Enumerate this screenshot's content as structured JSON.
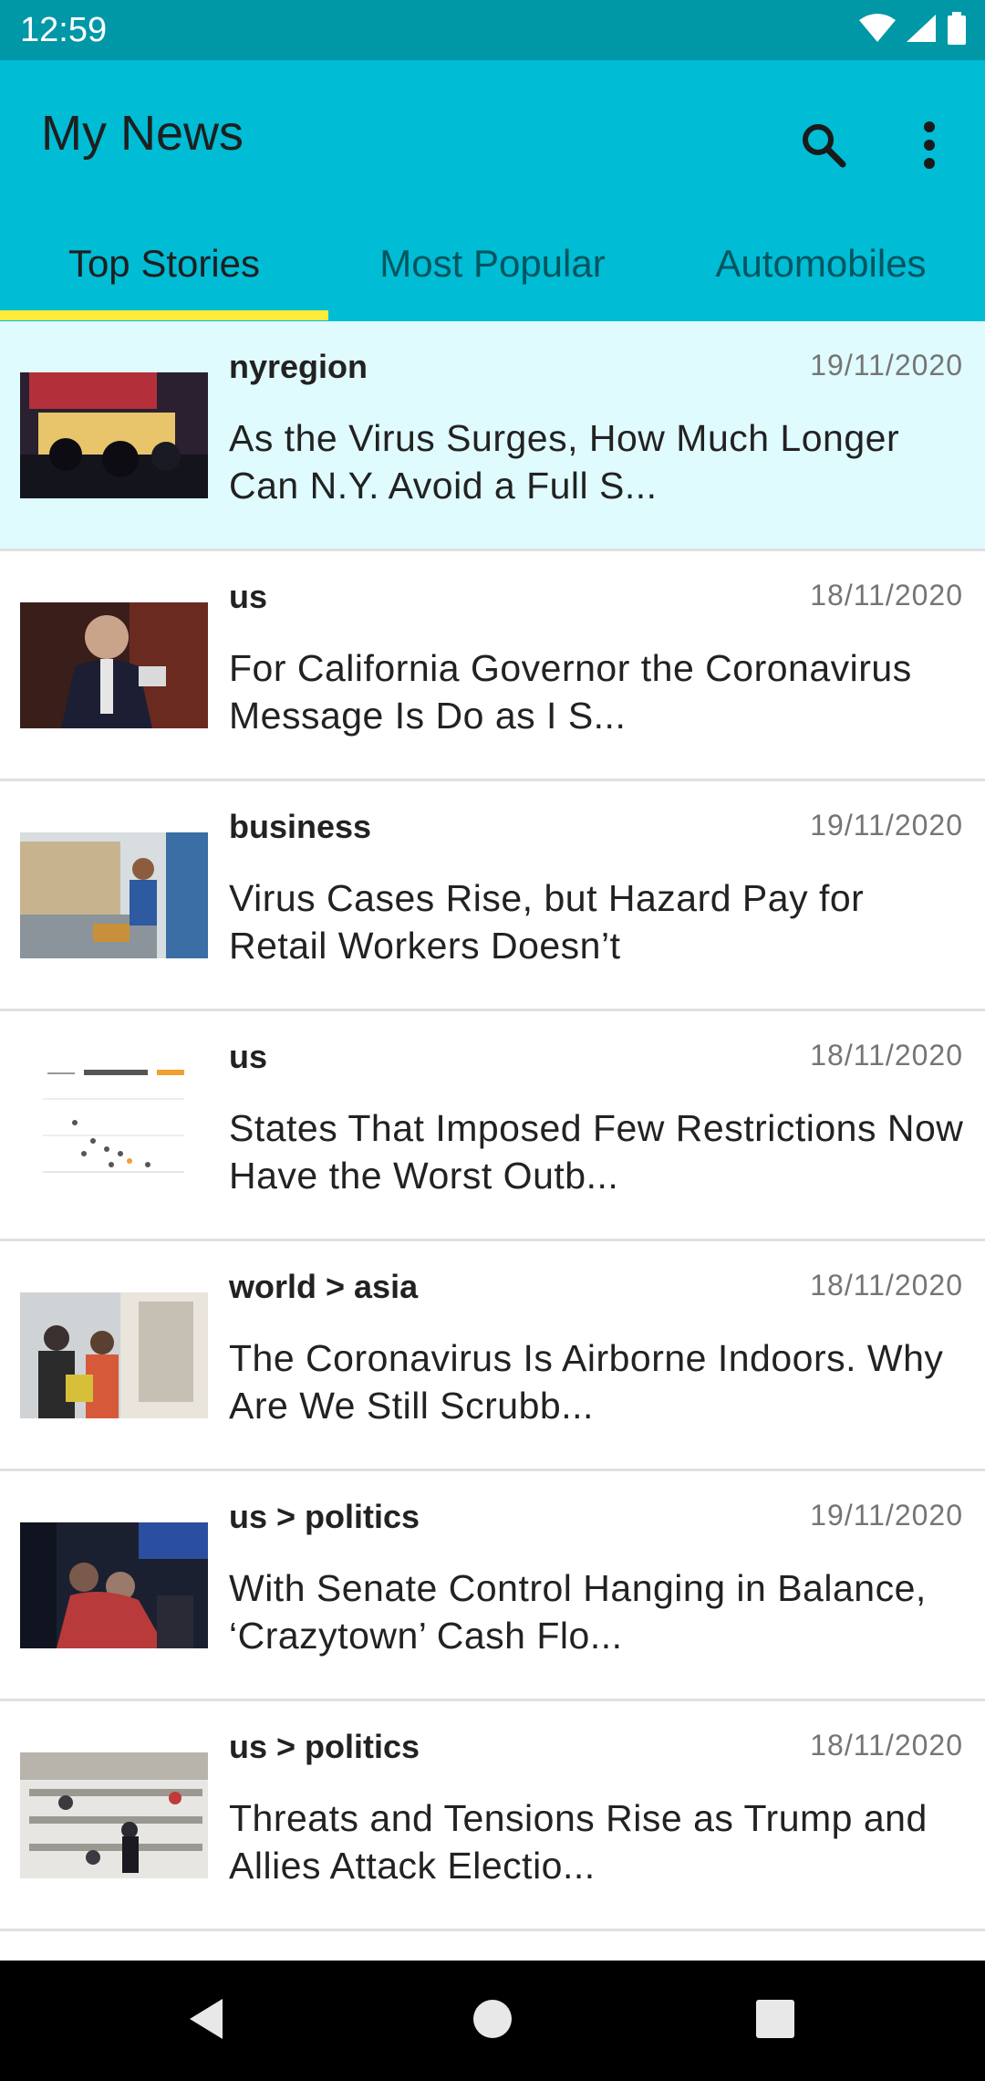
{
  "status_bar": {
    "time": "12:59",
    "icons": [
      "wifi-icon",
      "signal-icon",
      "battery-icon"
    ]
  },
  "app_bar": {
    "title": "My News",
    "actions": [
      "search-icon",
      "more-vert-icon"
    ]
  },
  "tabs": [
    {
      "label": "Top Stories",
      "active": true
    },
    {
      "label": "Most Popular",
      "active": false
    },
    {
      "label": "Automobiles",
      "active": false
    }
  ],
  "articles": [
    {
      "section": "nyregion",
      "date": "19/11/2020",
      "headline": "As the Virus Surges, How Much Longer Can N.Y. Avoid a Full S...",
      "selected": true
    },
    {
      "section": "us",
      "date": "18/11/2020",
      "headline": "For California Governor the Coronavirus Message Is Do as I S...",
      "selected": false
    },
    {
      "section": "business",
      "date": "19/11/2020",
      "headline": "Virus Cases Rise, but Hazard Pay for Retail Workers Doesn’t",
      "selected": false
    },
    {
      "section": "us",
      "date": "18/11/2020",
      "headline": "States That Imposed Few Restrictions Now Have the Worst Outb...",
      "selected": false
    },
    {
      "section": "world > asia",
      "date": "18/11/2020",
      "headline": "The Coronavirus Is Airborne Indoors. Why Are We Still Scrubb...",
      "selected": false
    },
    {
      "section": "us > politics",
      "date": "19/11/2020",
      "headline": "With Senate Control Hanging in Balance, ‘Crazytown’ Cash Flo...",
      "selected": false
    },
    {
      "section": "us > politics",
      "date": "18/11/2020",
      "headline": "Threats and Tensions Rise as Trump and Allies Attack Electio...",
      "selected": false
    }
  ],
  "nav_bar": [
    "back-icon",
    "home-icon",
    "recents-icon"
  ],
  "colors": {
    "status_bar": "#0097a7",
    "app_bar": "#00bcd4",
    "tab_indicator": "#ffeb3b",
    "selected_row": "#e0fbfd"
  }
}
